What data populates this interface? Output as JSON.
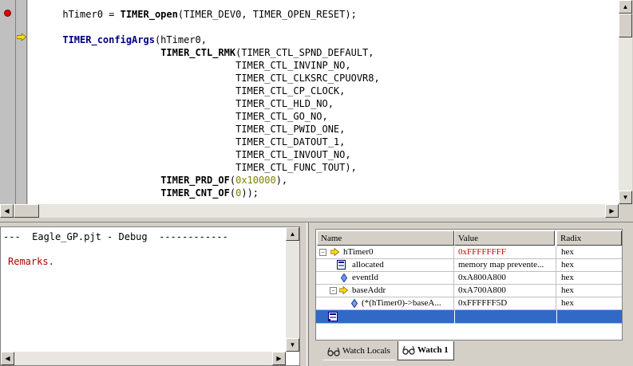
{
  "editor": {
    "code_lines": [
      [
        {
          "t": "hTimer0 = "
        },
        {
          "t": "TIMER_open",
          "c": "fn"
        },
        {
          "t": "(TIMER_DEV0, TIMER_OPEN_RESET);"
        }
      ],
      [],
      [
        {
          "t": "TIMER_configArgs",
          "c": "kw"
        },
        {
          "t": "(hTimer0,"
        }
      ],
      [
        {
          "t": "                 "
        },
        {
          "t": "TIMER_CTL_RMK",
          "c": "fn"
        },
        {
          "t": "(TIMER_CTL_SPND_DEFAULT,"
        }
      ],
      [
        {
          "t": "                              TIMER_CTL_INVINP_NO,"
        }
      ],
      [
        {
          "t": "                              TIMER_CTL_CLKSRC_CPUOVR8,"
        }
      ],
      [
        {
          "t": "                              TIMER_CTL_CP_CLOCK,"
        }
      ],
      [
        {
          "t": "                              TIMER_CTL_HLD_NO,"
        }
      ],
      [
        {
          "t": "                              TIMER_CTL_GO_NO,"
        }
      ],
      [
        {
          "t": "                              TIMER_CTL_PWID_ONE,"
        }
      ],
      [
        {
          "t": "                              TIMER_CTL_DATOUT_1,"
        }
      ],
      [
        {
          "t": "                              TIMER_CTL_INVOUT_NO,"
        }
      ],
      [
        {
          "t": "                              TIMER_CTL_FUNC_TOUT),"
        }
      ],
      [
        {
          "t": "                 "
        },
        {
          "t": "TIMER_PRD_OF",
          "c": "fn"
        },
        {
          "t": "("
        },
        {
          "t": "0x10000",
          "c": "num"
        },
        {
          "t": "),"
        }
      ],
      [
        {
          "t": "                 "
        },
        {
          "t": "TIMER_CNT_OF",
          "c": "fn"
        },
        {
          "t": "("
        },
        {
          "t": "0",
          "c": "num"
        },
        {
          "t": "));"
        }
      ]
    ]
  },
  "output": {
    "header": "---  Eagle_GP.pjt - Debug  ------------",
    "remarks": "Remarks."
  },
  "watch": {
    "columns": {
      "name": "Name",
      "value": "Value",
      "radix": "Radix"
    },
    "rows": [
      {
        "name": "hTimer0",
        "value": "0xFFFFFFFF",
        "radix": "hex",
        "value_red": true
      },
      {
        "name": "allocated",
        "value": "memory map prevente...",
        "radix": "hex"
      },
      {
        "name": "eventId",
        "value": "0xA800A800",
        "radix": "hex"
      },
      {
        "name": "baseAddr",
        "value": "0xA700A800",
        "radix": "hex"
      },
      {
        "name": "(*(hTimer0)->baseA...",
        "value": "0xFFFFFF5D",
        "radix": "hex"
      }
    ],
    "tabs": {
      "locals": "Watch Locals",
      "watch1": "Watch 1"
    },
    "colors": {
      "selection": "#3169c6",
      "changed_value": "#d00000"
    }
  }
}
